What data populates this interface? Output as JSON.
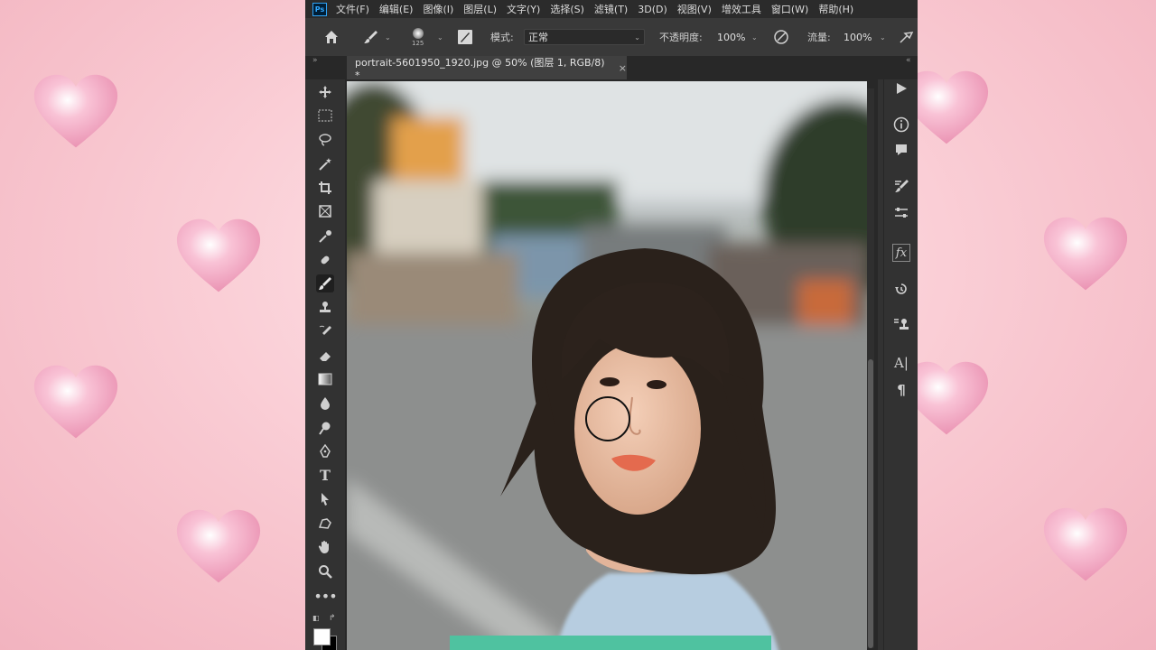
{
  "menubar": {
    "logo": "Ps",
    "items": [
      "文件(F)",
      "编辑(E)",
      "图像(I)",
      "图层(L)",
      "文字(Y)",
      "选择(S)",
      "滤镜(T)",
      "3D(D)",
      "视图(V)",
      "增效工具",
      "窗口(W)",
      "帮助(H)"
    ]
  },
  "options": {
    "brush_size": "125",
    "mode_label": "模式:",
    "mode_value": "正常",
    "opacity_label": "不透明度:",
    "opacity_value": "100%",
    "flow_label": "流量:",
    "flow_value": "100%"
  },
  "document": {
    "tab_title": "portrait-5601950_1920.jpg @ 50% (图层 1, RGB/8) *",
    "close": "×"
  },
  "toolbar_icons": [
    "move-icon",
    "marquee-icon",
    "lasso-icon",
    "magic-wand-icon",
    "crop-icon",
    "frame-icon",
    "eyedropper-icon",
    "healing-brush-icon",
    "brush-icon",
    "stamp-icon",
    "history-brush-icon",
    "eraser-icon",
    "gradient-icon",
    "blur-icon",
    "dodge-icon",
    "pen-icon",
    "type-icon",
    "path-select-icon",
    "shape-icon",
    "hand-icon",
    "zoom-icon",
    "more-icon"
  ],
  "right_panel_icons": [
    "play-icon",
    "info-icon",
    "comment-icon",
    "brush-settings-icon",
    "adjustments-icon",
    "fx-icon",
    "history-icon",
    "clone-source-icon",
    "character-icon",
    "paragraph-icon"
  ],
  "colors": {
    "accent_green": "#4fc2a0",
    "background_pink": "#f8c6cf",
    "ps_dark": "#323232"
  }
}
